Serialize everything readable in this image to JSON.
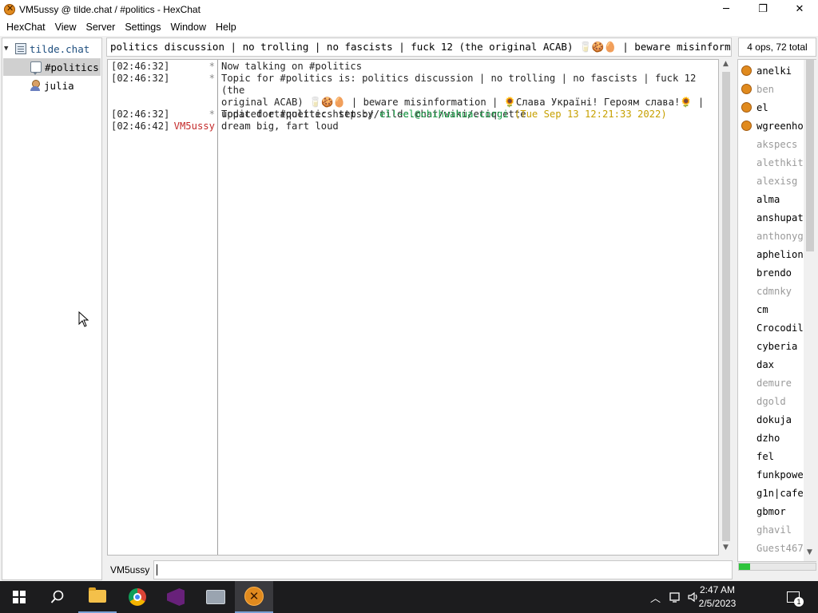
{
  "window": {
    "title": "VM5ussy @ tilde.chat / #politics - HexChat",
    "minimize_glyph": "─",
    "maximize_glyph": "❐",
    "close_glyph": "✕",
    "app_icon": "hexchat-icon"
  },
  "menu": [
    "HexChat",
    "View",
    "Server",
    "Settings",
    "Window",
    "Help"
  ],
  "tree": {
    "server": "tilde.chat",
    "channel": "#politics",
    "query": "julia"
  },
  "topic": "politics discussion | no trolling | no fascists | fuck 12 (the original ACAB) 🥛🍪🥚 | beware misinformation |",
  "user_count": "4 ops, 72 total",
  "messages": [
    {
      "ts": "[02:46:32]",
      "nick": "*",
      "body": "Now talking on #politics"
    },
    {
      "ts": "[02:46:32]",
      "nick": "*",
      "body_lines": [
        "Topic for #politics is: politics discussion | no trolling | no fascists | fuck 12 (the",
        "original ACAB) 🥛🍪🥚 | beware misinformation | 🌻Слава Україні! Героям слава!🌻 |",
        "updated etiquette: https://tilde.chat/wiki/etiquette"
      ]
    },
    {
      "ts": "[02:46:32]",
      "nick": "*",
      "body_prefix": "Topic for #politics set by ",
      "body_host": "el!~el@chihuahua.corgi",
      "body_time": "(Tue Sep 13 12:21:33 2022)"
    },
    {
      "ts": "[02:46:42]",
      "nick": "VM5ussy",
      "body": "dream big, fart loud"
    }
  ],
  "users": [
    {
      "name": "anelki",
      "op": true,
      "away": false
    },
    {
      "name": "ben",
      "op": true,
      "away": true
    },
    {
      "name": "el",
      "op": true,
      "away": false
    },
    {
      "name": "wgreenho",
      "op": true,
      "away": false
    },
    {
      "name": "akspecs",
      "op": false,
      "away": true
    },
    {
      "name": "alethkit",
      "op": false,
      "away": true
    },
    {
      "name": "alexisg",
      "op": false,
      "away": true
    },
    {
      "name": "alma",
      "op": false,
      "away": false
    },
    {
      "name": "anshupat",
      "op": false,
      "away": false
    },
    {
      "name": "anthonyg",
      "op": false,
      "away": true
    },
    {
      "name": "aphelion",
      "op": false,
      "away": false
    },
    {
      "name": "brendo",
      "op": false,
      "away": false
    },
    {
      "name": "cdmnky",
      "op": false,
      "away": true
    },
    {
      "name": "cm",
      "op": false,
      "away": false
    },
    {
      "name": "Crocodil",
      "op": false,
      "away": false
    },
    {
      "name": "cyberia",
      "op": false,
      "away": false
    },
    {
      "name": "dax",
      "op": false,
      "away": false
    },
    {
      "name": "demure",
      "op": false,
      "away": true
    },
    {
      "name": "dgold",
      "op": false,
      "away": true
    },
    {
      "name": "dokuja",
      "op": false,
      "away": false
    },
    {
      "name": "dzho",
      "op": false,
      "away": false
    },
    {
      "name": "fel",
      "op": false,
      "away": false
    },
    {
      "name": "funkpowe",
      "op": false,
      "away": false
    },
    {
      "name": "g1n|cafe",
      "op": false,
      "away": false
    },
    {
      "name": "gbmor",
      "op": false,
      "away": false
    },
    {
      "name": "ghavil",
      "op": false,
      "away": true
    },
    {
      "name": "Guest467",
      "op": false,
      "away": true
    }
  ],
  "input": {
    "nick": "VM5ussy",
    "value": ""
  },
  "lag_level": 0.15,
  "colors": {
    "op_dot": "#e08a1e",
    "self_nick": "#c42b2b",
    "host": "#1ba34a",
    "timestamp_quote": "#c7a000"
  },
  "taskbar": {
    "icons": [
      "windows-start-icon",
      "search-icon",
      "file-explorer-icon",
      "chrome-icon",
      "visual-studio-icon",
      "vm-icon",
      "hexchat-icon"
    ],
    "tray": [
      "chevron-up-icon",
      "network-icon",
      "speaker-icon",
      "notification-icon"
    ],
    "clock_time": "2:47 AM",
    "clock_date": "2/5/2023",
    "notification_count": "1"
  }
}
